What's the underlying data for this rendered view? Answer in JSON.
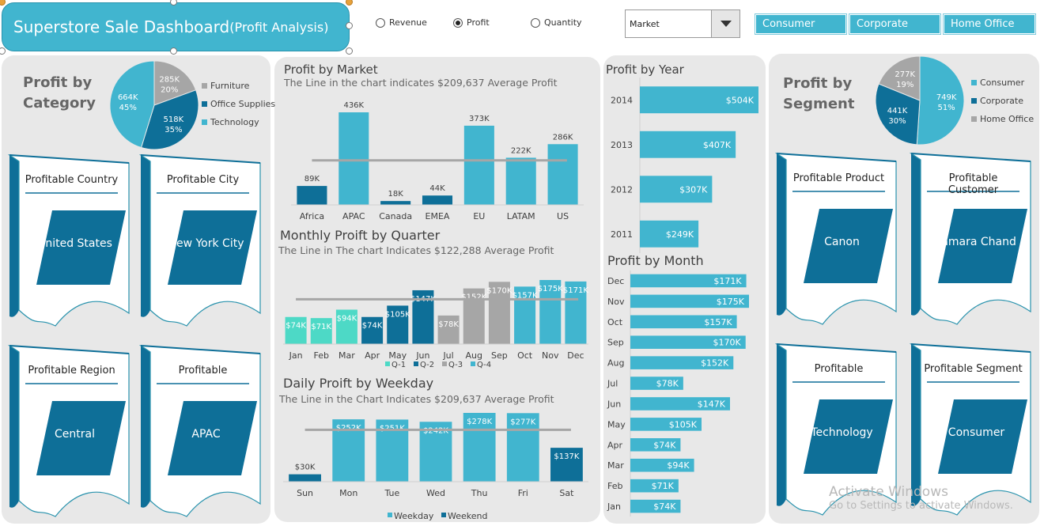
{
  "header": {
    "title_main": "Superstore Sale Dashboard",
    "title_sub": "(Profit Analysis)"
  },
  "metric_options": [
    {
      "label": "Revenue",
      "selected": false
    },
    {
      "label": "Profit",
      "selected": true
    },
    {
      "label": "Quantity",
      "selected": false
    }
  ],
  "dropdown": {
    "value": "Market"
  },
  "segment_buttons": [
    "Consumer",
    "Corporate",
    "Home Office"
  ],
  "colors": {
    "accent": "#41b5cf",
    "dark": "#0e6f98",
    "grey": "#a6a6a6",
    "teal_light": "#4dd9c6",
    "panel": "#e8e8e8"
  },
  "category_panel": {
    "title_line1": "Profit by",
    "title_line2": "Category",
    "legend": [
      "Furniture",
      "Office Supplies",
      "Technology"
    ]
  },
  "segment_panel": {
    "title_line1": "Profit by",
    "title_line2": "Segment",
    "legend": [
      "Consumer",
      "Corporate",
      "Home Office"
    ]
  },
  "cards_left": [
    {
      "label": "Profitable Country",
      "value": "United States"
    },
    {
      "label": "Profitable City",
      "value": "New York City"
    },
    {
      "label": "Profitable Region",
      "value": "Central"
    },
    {
      "label": "Profitable",
      "value": "APAC"
    }
  ],
  "cards_right": [
    {
      "label": "Profitable Product",
      "value": "Canon"
    },
    {
      "label": "Profitable Customer",
      "value": "Tamara Chand"
    },
    {
      "label": "Profitable",
      "value": "Technology"
    },
    {
      "label": "Profitable Segment",
      "value": "Consumer"
    }
  ],
  "market_chart": {
    "title": "Profit by Market",
    "subtitle": "The Line in the chart indicates $209,637 Average Profit"
  },
  "quarter_chart": {
    "title": "Monthly Proift by Quarter",
    "subtitle": "The Line in The chart Indicates $122,288 Average Profit"
  },
  "weekday_chart": {
    "title": "Daily Proift by Weekday",
    "subtitle": "The Line in the Chart Indicates $209,637 Average Profit"
  },
  "year_chart": {
    "title": "Profit by Year"
  },
  "month_chart": {
    "title": "Profit by Month"
  },
  "watermark": {
    "line1": "Activate Windows",
    "line2": "Go to Settings to activate Windows."
  },
  "chart_data": [
    {
      "type": "pie",
      "name": "category",
      "categories": [
        "Furniture",
        "Office Supplies",
        "Technology"
      ],
      "values": [
        285,
        518,
        664
      ],
      "value_labels": [
        "285K",
        "518K",
        "664K"
      ],
      "percent_labels": [
        "20%",
        "35%",
        "45%"
      ],
      "colors": [
        "#a6a6a6",
        "#0e6f98",
        "#41b5cf"
      ]
    },
    {
      "type": "pie",
      "name": "segment",
      "categories": [
        "Consumer",
        "Corporate",
        "Home Office"
      ],
      "values": [
        749,
        441,
        277
      ],
      "value_labels": [
        "749K",
        "441K",
        "277K"
      ],
      "percent_labels": [
        "51%",
        "30%",
        "19%"
      ],
      "colors": [
        "#41b5cf",
        "#0e6f98",
        "#a6a6a6"
      ]
    },
    {
      "type": "bar",
      "name": "market",
      "categories": [
        "Africa",
        "APAC",
        "Canada",
        "EMEA",
        "EU",
        "LATAM",
        "US"
      ],
      "values": [
        89,
        436,
        18,
        44,
        373,
        222,
        286
      ],
      "value_labels": [
        "89K",
        "436K",
        "18K",
        "44K",
        "373K",
        "222K",
        "286K"
      ],
      "colors": [
        "#0e6f98",
        "#41b5cf",
        "#0e6f98",
        "#0e6f98",
        "#41b5cf",
        "#41b5cf",
        "#41b5cf"
      ],
      "average": 209.637
    },
    {
      "type": "bar",
      "name": "quarter",
      "categories": [
        "Jan",
        "Feb",
        "Mar",
        "Apr",
        "May",
        "Jun",
        "Jul",
        "Aug",
        "Sep",
        "Oct",
        "Nov",
        "Dec"
      ],
      "values": [
        74,
        71,
        94,
        74,
        105,
        147,
        78,
        152,
        170,
        157,
        175,
        171
      ],
      "value_labels": [
        "$74K",
        "$71K",
        "$94K",
        "$74K",
        "$105K",
        "$147K",
        "$78K",
        "$152K",
        "$170K",
        "$157K",
        "$175K",
        "$171K"
      ],
      "quarter": [
        1,
        1,
        1,
        2,
        2,
        2,
        3,
        3,
        3,
        4,
        4,
        4
      ],
      "series": [
        {
          "name": "Q-1",
          "color": "#4dd9c6"
        },
        {
          "name": "Q-2",
          "color": "#0e6f98"
        },
        {
          "name": "Q-3",
          "color": "#a6a6a6"
        },
        {
          "name": "Q-4",
          "color": "#41b5cf"
        }
      ],
      "average": 122.288
    },
    {
      "type": "bar",
      "name": "weekday",
      "categories": [
        "Sun",
        "Mon",
        "Tue",
        "Wed",
        "Thu",
        "Fri",
        "Sat"
      ],
      "values": [
        30,
        252,
        251,
        242,
        278,
        277,
        137
      ],
      "value_labels": [
        "$30K",
        "$252K",
        "$251K",
        "$242K",
        "$278K",
        "$277K",
        "$137K"
      ],
      "series_of": [
        "Weekend",
        "Weekday",
        "Weekday",
        "Weekday",
        "Weekday",
        "Weekday",
        "Weekend"
      ],
      "series": [
        {
          "name": "Weekday",
          "color": "#41b5cf"
        },
        {
          "name": "Weekend",
          "color": "#0e6f98"
        }
      ],
      "average": 209.637
    },
    {
      "type": "bar",
      "orientation": "horizontal",
      "name": "year",
      "categories": [
        "2014",
        "2013",
        "2012",
        "2011"
      ],
      "values": [
        504,
        407,
        307,
        249
      ],
      "value_labels": [
        "$504K",
        "$407K",
        "$307K",
        "$249K"
      ]
    },
    {
      "type": "bar",
      "orientation": "horizontal",
      "name": "month",
      "categories": [
        "Dec",
        "Nov",
        "Oct",
        "Sep",
        "Aug",
        "Jul",
        "Jun",
        "May",
        "Apr",
        "Mar",
        "Feb",
        "Jan"
      ],
      "values": [
        171,
        175,
        157,
        170,
        152,
        78,
        147,
        105,
        74,
        94,
        71,
        74
      ],
      "value_labels": [
        "$171K",
        "$175K",
        "$157K",
        "$170K",
        "$152K",
        "$78K",
        "$147K",
        "$105K",
        "$74K",
        "$94K",
        "$71K",
        "$74K"
      ]
    }
  ]
}
